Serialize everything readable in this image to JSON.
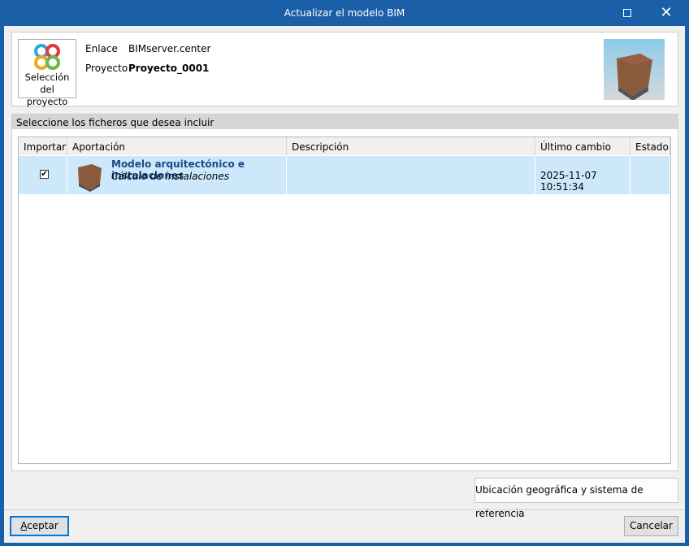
{
  "window": {
    "title": "Actualizar el modelo BIM"
  },
  "project": {
    "button_label_1": "Selección",
    "button_label_2": "del proyecto",
    "link_label": "Enlace",
    "link_value": "BIMserver.center",
    "project_label": "Proyecto",
    "project_value": "Proyecto_0001"
  },
  "files": {
    "section_title": "Seleccione los ficheros que desea incluir",
    "columns": [
      "Importar",
      "Aportación",
      "Descripción",
      "Último cambio",
      "Estado"
    ],
    "rows": [
      {
        "checked": true,
        "title": "Modelo arquitectónico e instalaciones",
        "subtitle": "Cálculo de instalaciones",
        "description": "",
        "last_change": "2025-11-07 10:51:34",
        "status": ""
      }
    ]
  },
  "buttons": {
    "geo": "Ubicación geográfica y sistema de referencia",
    "accept_accel": "A",
    "accept_rest": "ceptar",
    "cancel": "Cancelar"
  },
  "colors": {
    "titlebar": "#1a5fa8",
    "selection": "#cce8fa",
    "link_title": "#1a4a8a"
  }
}
